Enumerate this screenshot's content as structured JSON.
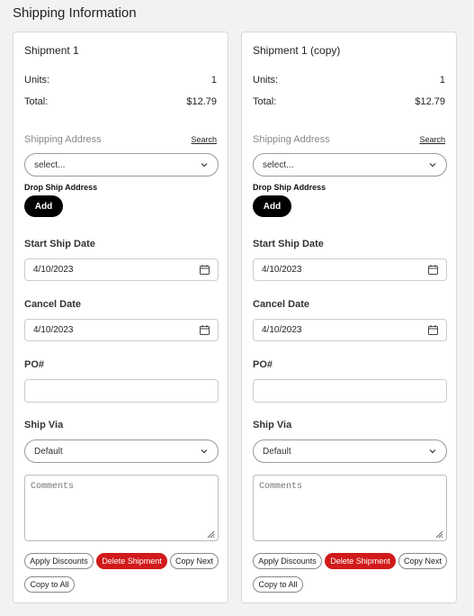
{
  "page": {
    "title": "Shipping Information"
  },
  "colors": {
    "danger": "#d11a1a",
    "primary": "#000000"
  },
  "shipments": [
    {
      "title": "Shipment 1",
      "units_label": "Units:",
      "units_value": "1",
      "total_label": "Total:",
      "total_value": "$12.79",
      "shipping_address_label": "Shipping Address",
      "search_link": "Search",
      "address_select": "select...",
      "drop_ship_label": "Drop Ship Address",
      "add_button": "Add",
      "start_ship_label": "Start Ship Date",
      "start_ship_value": "4/10/2023",
      "cancel_label": "Cancel Date",
      "cancel_value": "4/10/2023",
      "po_label": "PO#",
      "po_value": "",
      "ship_via_label": "Ship Via",
      "ship_via_value": "Default",
      "comments_placeholder": "Comments",
      "buttons": {
        "apply_discounts": "Apply Discounts",
        "delete_shipment": "Delete Shipment",
        "copy_next": "Copy Next",
        "copy_to_all": "Copy to All"
      }
    },
    {
      "title": "Shipment 1 (copy)",
      "units_label": "Units:",
      "units_value": "1",
      "total_label": "Total:",
      "total_value": "$12.79",
      "shipping_address_label": "Shipping Address",
      "search_link": "Search",
      "address_select": "select...",
      "drop_ship_label": "Drop Ship Address",
      "add_button": "Add",
      "start_ship_label": "Start Ship Date",
      "start_ship_value": "4/10/2023",
      "cancel_label": "Cancel Date",
      "cancel_value": "4/10/2023",
      "po_label": "PO#",
      "po_value": "",
      "ship_via_label": "Ship Via",
      "ship_via_value": "Default",
      "comments_placeholder": "Comments",
      "buttons": {
        "apply_discounts": "Apply Discounts",
        "delete_shipment": "Delete Shipment",
        "copy_next": "Copy Next",
        "copy_to_all": "Copy to All"
      }
    }
  ]
}
